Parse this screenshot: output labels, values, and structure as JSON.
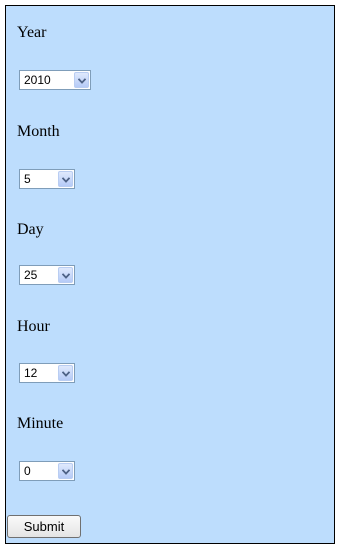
{
  "form": {
    "fields": [
      {
        "label": "Year",
        "value": "2010"
      },
      {
        "label": "Month",
        "value": "5"
      },
      {
        "label": "Day",
        "value": "25"
      },
      {
        "label": "Hour",
        "value": "12"
      },
      {
        "label": "Minute",
        "value": "0"
      }
    ],
    "submit_label": "Submit"
  },
  "colors": {
    "background": "#bdddfd",
    "border": "#000000"
  },
  "icons": {
    "dropdown": "chevron-down-icon"
  }
}
